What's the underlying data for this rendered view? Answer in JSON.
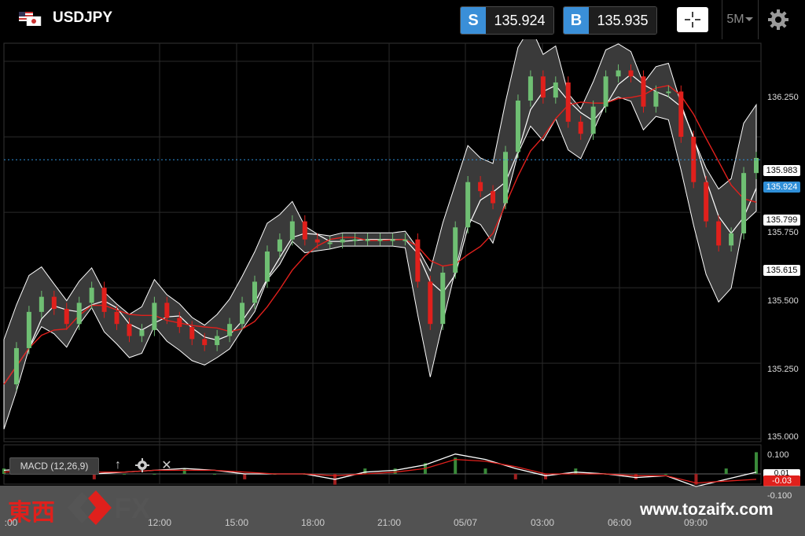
{
  "header": {
    "symbol": "USDJPY",
    "sell_label": "S",
    "sell_price": "135.924",
    "buy_label": "B",
    "buy_price": "135.935",
    "timeframe": "5M",
    "icons": [
      "us-jp-flag-icon",
      "crosshair-icon",
      "chevron-down-icon",
      "gear-icon"
    ]
  },
  "price_axis": [
    "136.250",
    "135.750",
    "135.500",
    "135.250",
    "135.000"
  ],
  "price_tags": {
    "upper_band": "135.983",
    "bid": "135.924",
    "middle_band": "135.799",
    "lower_band": "135.615"
  },
  "indicator": {
    "label": "MACD (12,26,9)",
    "axis": [
      "0.100",
      "-0.100"
    ],
    "macd_value": "0.01",
    "signal_value": "-0.03"
  },
  "time_axis": [
    ":00",
    "12:00",
    "15:00",
    "18:00",
    "21:00",
    "05/07",
    "03:00",
    "06:00",
    "09:00"
  ],
  "watermark": {
    "logo_cn": "東西",
    "logo_fx": "FX",
    "site": "www.tozaifx.com"
  },
  "colors": {
    "up_candle": "#6fbf73",
    "down_candle": "#e0201c",
    "band": "#ffffff",
    "ma": "#e0201c",
    "accent": "#3a8fd8"
  },
  "chart_data": {
    "type": "candlestick",
    "title": "USDJPY",
    "ylim": [
      135.0,
      136.3
    ],
    "close_series": [
      135.18,
      135.3,
      135.42,
      135.47,
      135.43,
      135.38,
      135.45,
      135.5,
      135.42,
      135.38,
      135.34,
      135.36,
      135.45,
      135.4,
      135.37,
      135.33,
      135.31,
      135.34,
      135.38,
      135.45,
      135.52,
      135.62,
      135.66,
      135.72,
      135.66,
      135.65,
      135.65,
      135.66,
      135.66,
      135.66,
      135.66,
      135.66,
      135.66,
      135.52,
      135.38,
      135.55,
      135.7,
      135.85,
      135.82,
      135.78,
      135.95,
      136.12,
      136.2,
      136.13,
      136.18,
      136.05,
      136.01,
      136.1,
      136.2,
      136.22,
      136.2,
      136.1,
      136.15,
      136.15,
      136.0,
      135.85,
      135.72,
      135.64,
      135.68,
      135.88,
      135.93
    ],
    "upper_band_last": 135.983,
    "middle_band_last": 135.799,
    "lower_band_last": 135.615,
    "macd_series": [
      0.02,
      0.03,
      0.02,
      0.0,
      0.01,
      0.02,
      0.03,
      0.02,
      0.0,
      0.0,
      0.0,
      -0.03,
      0.01,
      0.02,
      0.05,
      0.11,
      0.08,
      0.03,
      -0.01,
      0.01,
      0.0,
      -0.02,
      -0.01,
      -0.07,
      -0.03,
      0.01
    ],
    "signal_series": [
      0.01,
      0.02,
      0.02,
      0.01,
      0.01,
      0.02,
      0.02,
      0.02,
      0.01,
      0.0,
      0.0,
      -0.01,
      0.0,
      0.01,
      0.03,
      0.08,
      0.07,
      0.04,
      0.0,
      0.0,
      0.0,
      -0.01,
      -0.01,
      -0.05,
      -0.04,
      -0.03
    ]
  }
}
